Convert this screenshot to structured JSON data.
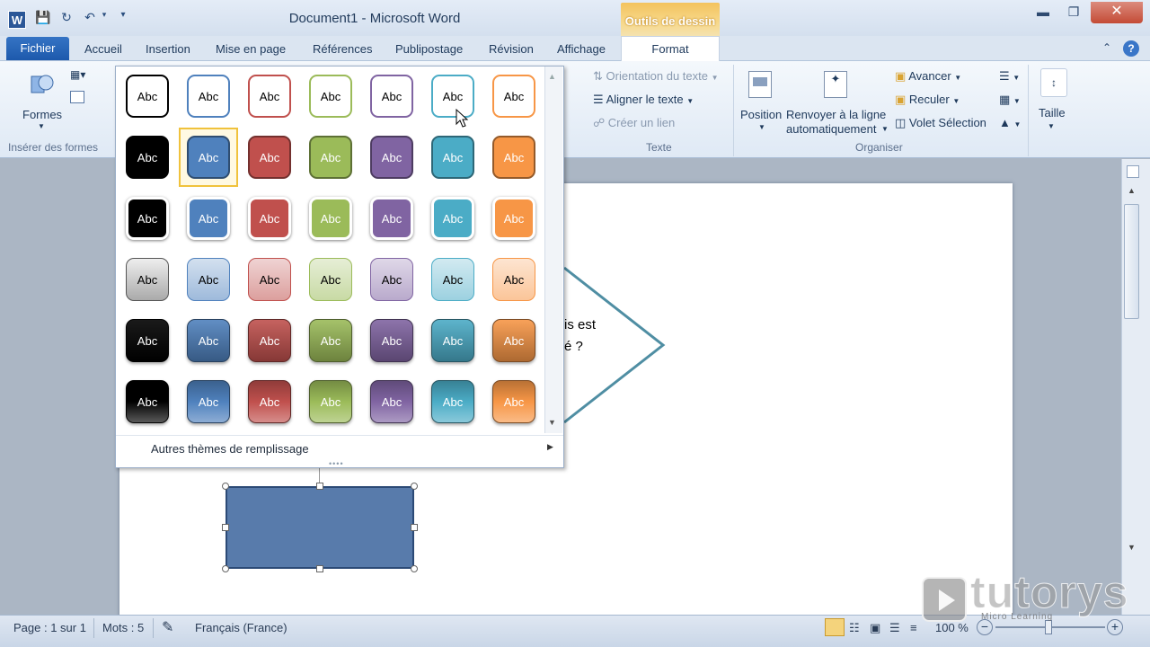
{
  "window": {
    "title": "Document1 - Microsoft Word",
    "contextual_tab": "Outils de dessin"
  },
  "tabs": {
    "file": "Fichier",
    "items": [
      "Accueil",
      "Insertion",
      "Mise en page",
      "Références",
      "Publipostage",
      "Révision",
      "Affichage"
    ],
    "active": "Format"
  },
  "ribbon": {
    "formes_label": "Formes",
    "group_inserer": "Insérer des formes",
    "texte": {
      "orientation": "Orientation du texte",
      "aligner": "Aligner le texte",
      "lien": "Créer un lien",
      "group": "Texte"
    },
    "organiser": {
      "position": "Position",
      "renvoyer_1": "Renvoyer à la ligne",
      "renvoyer_2": "automatiquement",
      "avancer": "Avancer",
      "reculer": "Reculer",
      "volet": "Volet Sélection",
      "group": "Organiser"
    },
    "taille": "Taille"
  },
  "gallery": {
    "swatch_label": "Abc",
    "more_label": "Autres thèmes de remplissage",
    "colors": [
      "#000000",
      "#4f81bd",
      "#c0504d",
      "#9bbb59",
      "#8064a2",
      "#4bacc6",
      "#f79646"
    ],
    "selected": {
      "row": 1,
      "col": 1
    }
  },
  "document": {
    "text_line1": "is est",
    "text_line2": "é ?",
    "shape_fill": "#587bab"
  },
  "status": {
    "page": "Page : 1 sur 1",
    "words": "Mots : 5",
    "language": "Français (France)",
    "zoom": "100 %"
  },
  "watermark": {
    "brand": "tutorys",
    "tagline": "Micro Learning"
  }
}
